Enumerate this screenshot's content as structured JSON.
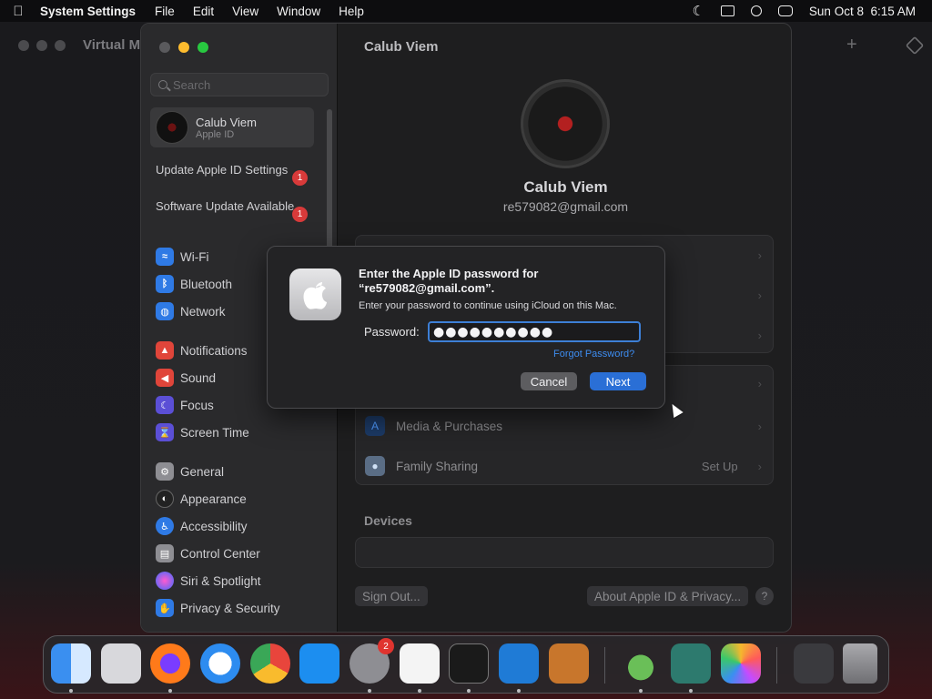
{
  "menubar": {
    "app_name": "System Settings",
    "items": [
      "File",
      "Edit",
      "View",
      "Window",
      "Help"
    ],
    "datetime": "Sun Oct 8  6:15 AM"
  },
  "vm_window": {
    "title": "Virtual M"
  },
  "sidebar": {
    "search_placeholder": "Search",
    "account": {
      "name": "Calub Viem",
      "subtitle": "Apple ID"
    },
    "notices": [
      {
        "label": "Update Apple ID Settings",
        "badge": "1"
      },
      {
        "label": "Software Update Available",
        "badge": "1"
      }
    ],
    "items": [
      {
        "label": "Wi-Fi",
        "icon": "wifi-icon",
        "color": "#2f7ae5"
      },
      {
        "label": "Bluetooth",
        "icon": "bluetooth-icon",
        "color": "#2f7ae5"
      },
      {
        "label": "Network",
        "icon": "globe-icon",
        "color": "#2f7ae5"
      },
      {
        "label": "Notifications",
        "icon": "bell-icon",
        "color": "#e0453a"
      },
      {
        "label": "Sound",
        "icon": "speaker-icon",
        "color": "#e0453a"
      },
      {
        "label": "Focus",
        "icon": "moon-icon",
        "color": "#5b4fd6"
      },
      {
        "label": "Screen Time",
        "icon": "hourglass-icon",
        "color": "#5b4fd6"
      },
      {
        "label": "General",
        "icon": "gear-icon",
        "color": "#8e8e93"
      },
      {
        "label": "Appearance",
        "icon": "appearance-icon",
        "color": "#222222"
      },
      {
        "label": "Accessibility",
        "icon": "accessibility-icon",
        "color": "#2f7ae5"
      },
      {
        "label": "Control Center",
        "icon": "control-center-icon",
        "color": "#8e8e93"
      },
      {
        "label": "Siri & Spotlight",
        "icon": "siri-icon",
        "color": "#c43ad9"
      },
      {
        "label": "Privacy & Security",
        "icon": "hand-icon",
        "color": "#2f7ae5"
      }
    ]
  },
  "content": {
    "title": "Calub Viem",
    "user_name": "Calub Viem",
    "user_email": "re579082@gmail.com",
    "rows": [
      {
        "label": "Media & Purchases",
        "value": ""
      },
      {
        "label": "Family Sharing",
        "value": "Set Up"
      }
    ],
    "devices_header": "Devices",
    "sign_out": "Sign Out...",
    "about": "About Apple ID & Privacy...",
    "help": "?"
  },
  "dialog": {
    "title": "Enter the Apple ID password for “re579082@gmail.com”.",
    "subtitle": "Enter your password to continue using iCloud on this Mac.",
    "password_label": "Password:",
    "password_value": "●●●●●●●●●●",
    "forgot": "Forgot Password?",
    "cancel": "Cancel",
    "next": "Next"
  },
  "dock": {
    "badge": "2",
    "apps": [
      {
        "name": "finder",
        "color": "#3a8ff0"
      },
      {
        "name": "launchpad",
        "color": "#d8d8dc"
      },
      {
        "name": "firefox",
        "color": "#ff7a1a"
      },
      {
        "name": "safari",
        "color": "#2d8cf0"
      },
      {
        "name": "chrome",
        "color": "#ffffff"
      },
      {
        "name": "app-store",
        "color": "#1c8ef0"
      },
      {
        "name": "system-settings",
        "color": "#8e8e93"
      },
      {
        "name": "textedit",
        "color": "#f4f4f4"
      },
      {
        "name": "terminal",
        "color": "#1a1a1a"
      },
      {
        "name": "vscode",
        "color": "#1f7bd6"
      },
      {
        "name": "garageband",
        "color": "#c8762c"
      },
      {
        "name": "installer",
        "color": "#6abf58"
      },
      {
        "name": "archive-utility",
        "color": "#2d7a6e"
      },
      {
        "name": "photos",
        "color": "#f5b82d"
      },
      {
        "name": "downloads",
        "color": "#3a3a3e"
      },
      {
        "name": "trash",
        "color": "#8c8c90"
      }
    ]
  }
}
